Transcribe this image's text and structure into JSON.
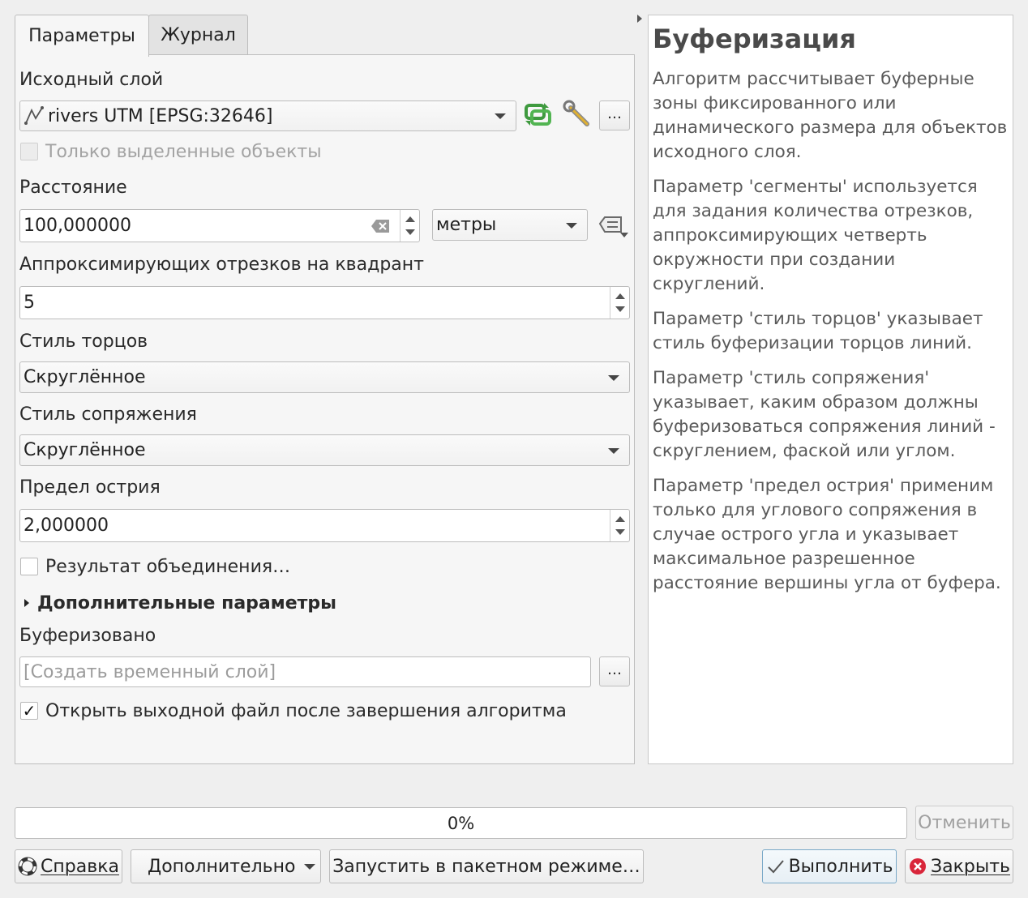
{
  "tabs": [
    {
      "label": "Параметры",
      "active": true
    },
    {
      "label": "Журнал",
      "active": false
    }
  ],
  "params": {
    "input_layer_label": "Исходный слой",
    "input_layer_value": "rivers UTM [EPSG:32646]",
    "selected_only_label": "Только выделенные объекты",
    "distance_label": "Расстояние",
    "distance_value": "100,000000",
    "distance_unit": "метры",
    "segments_label": "Аппроксимирующих отрезков на квадрант",
    "segments_value": "5",
    "end_cap_label": "Стиль торцов",
    "end_cap_value": "Скруглённое",
    "join_style_label": "Стиль сопряжения",
    "join_style_value": "Скруглённое",
    "miter_limit_label": "Предел острия",
    "miter_limit_value": "2,000000",
    "dissolve_label": "Результат объединения…",
    "advanced_label": "Дополнительные параметры",
    "output_label": "Буферизовано",
    "output_placeholder": "[Создать временный слой]",
    "open_output_label": "Открыть выходной файл после завершения алгоритма",
    "browse_label": "…"
  },
  "help": {
    "title": "Буферизация",
    "paragraphs": [
      "Алгоритм рассчитывает буферные зоны фиксированного или динамического размера для объектов исходного слоя.",
      "Параметр 'сегменты' используется для задания количества отрезков, аппроксимирующих четверть окружности при создании скруглений.",
      "Параметр 'стиль торцов' указывает стиль буферизации торцов линий.",
      "Параметр 'стиль сопряжения' указывает, каким образом должны буферизоваться сопряжения линий - скруглением, фаской или углом.",
      "Параметр 'предел острия' применим только для углового сопряжения в случае острого угла и указывает максимальное разрешенное расстояние вершины угла от буфера."
    ]
  },
  "progress": {
    "text": "0%",
    "value": 0
  },
  "buttons": {
    "cancel": "Отменить",
    "help": "Справка",
    "advanced": "Дополнительно",
    "batch": "Запустить в пакетном режиме…",
    "run": "Выполнить",
    "close": "Закрыть"
  },
  "colors": {
    "accent_green": "#3f9a3f",
    "close_red": "#d9263a",
    "default_border": "#7aa9c8"
  }
}
